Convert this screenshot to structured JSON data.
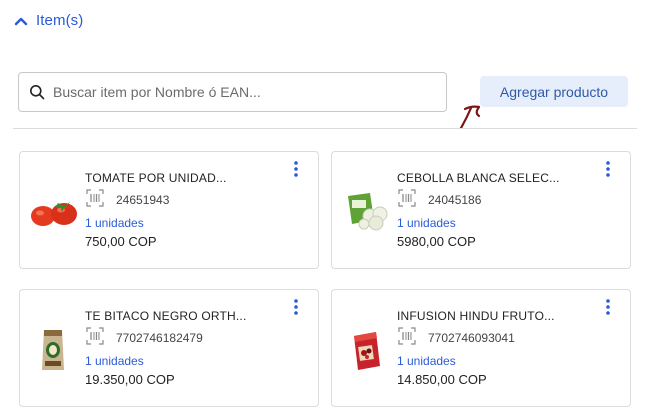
{
  "section": {
    "title": "Item(s)",
    "icon": "chevron-up-icon",
    "accent": "#2a5bd7"
  },
  "search": {
    "placeholder": "Buscar item por Nombre ó EAN...",
    "value": "",
    "icon": "search-icon"
  },
  "add_button": {
    "label": "Agregar producto",
    "bg": "#e7eefb",
    "color": "#2f5aa8"
  },
  "annotation": {
    "icon": "arrow-annotation-icon",
    "color": "#7a1616"
  },
  "items": [
    {
      "name": "TOMATE POR UNIDAD...",
      "ean": "24651943",
      "qty": "1 unidades",
      "price": "750,00 COP",
      "image": "tomato-image"
    },
    {
      "name": "CEBOLLA BLANCA SELEC...",
      "ean": "24045186",
      "qty": "1 unidades",
      "price": "5980,00 COP",
      "image": "onion-bag-image"
    },
    {
      "name": "TE BITACO NEGRO ORTH...",
      "ean": "7702746182479",
      "qty": "1 unidades",
      "price": "19.350,00 COP",
      "image": "tea-bag-image"
    },
    {
      "name": "INFUSION HINDU FRUTO...",
      "ean": "7702746093041",
      "qty": "1 unidades",
      "price": "14.850,00 COP",
      "image": "infusion-box-image"
    }
  ]
}
